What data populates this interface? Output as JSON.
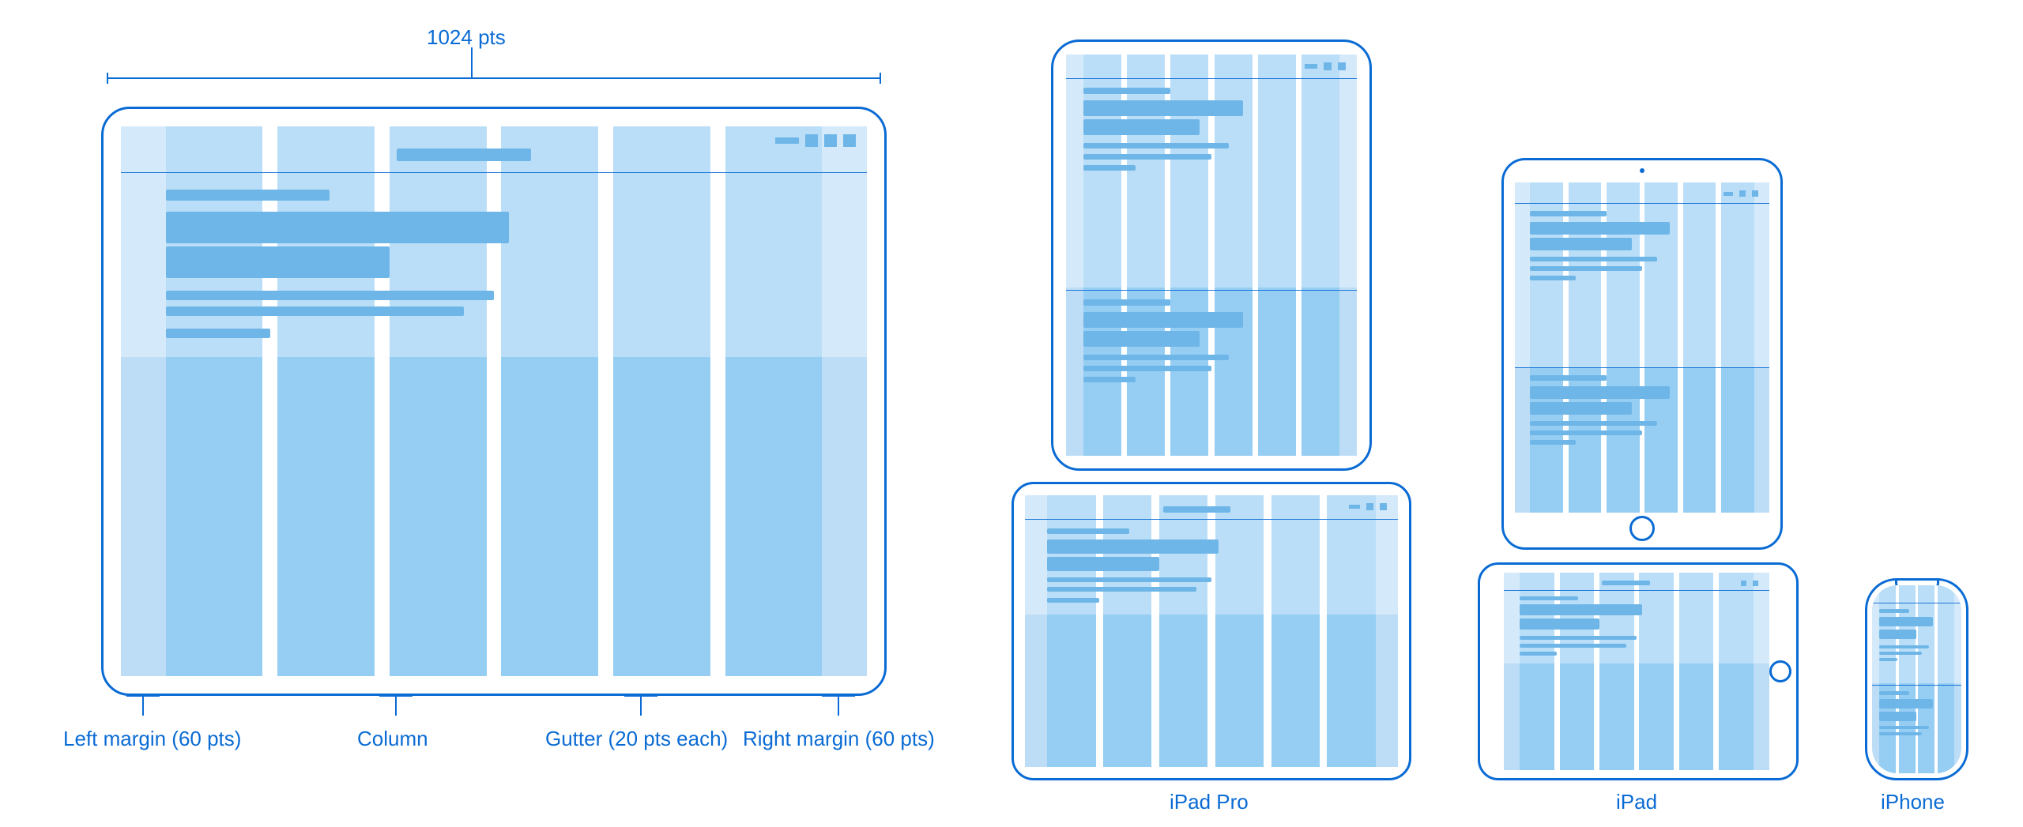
{
  "top_width_label": "1024 pts",
  "callouts": {
    "left": "Left margin (60 pts)",
    "column": "Column",
    "gutter": "Gutter (20 pts each)",
    "right": "Right margin (60 pts)"
  },
  "device_labels": {
    "ipad_pro": "iPad Pro",
    "ipad": "iPad",
    "iphone": "iPhone"
  },
  "grid": {
    "total_pts": 1024,
    "columns": 6,
    "left_margin_pts": 60,
    "right_margin_pts": 60,
    "gutter_pts": 20
  },
  "colors": {
    "outline": "#0a6bd4",
    "column_light": "#bdddf7",
    "column_dark": "#95cdf3",
    "overlay": "#6fb6e8"
  }
}
